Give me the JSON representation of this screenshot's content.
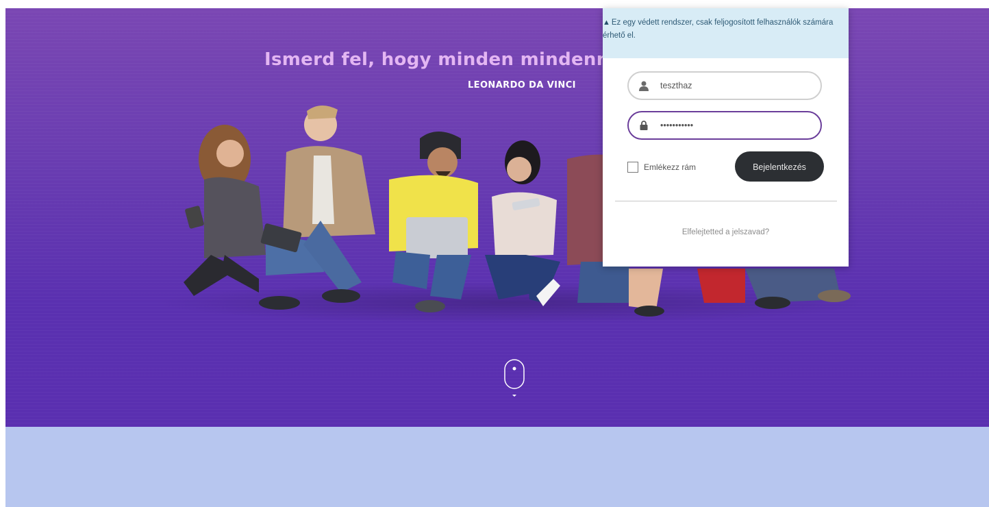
{
  "hero": {
    "quote": "Ismerd fel, hogy minden mindennel k",
    "author": "LEONARDO DA VINCI"
  },
  "login": {
    "alert_text": "Ez egy védett rendszer, csak feljogosított felhasználók számára érhető el.",
    "alert_icon": "warning-icon",
    "username_value": "teszthaz",
    "password_value": "•••••••••••",
    "remember_label": "Emlékezz rám",
    "remember_checked": false,
    "submit_label": "Bejelentkezés",
    "forgot_label": "Elfelejtetted a jelszavad?"
  },
  "colors": {
    "hero_top": "#7a47b3",
    "hero_bottom": "#5a2fb0",
    "band": "#b7c6ef",
    "button": "#2c2f33",
    "input_focus": "#6a3d9a",
    "alert_bg": "#d8ecf6"
  }
}
